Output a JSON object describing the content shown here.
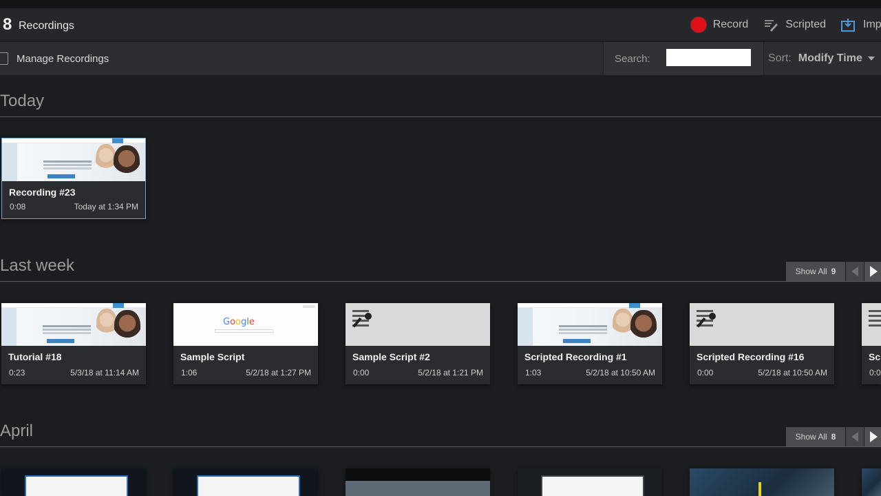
{
  "header": {
    "count": "8",
    "count_label": "Recordings",
    "actions": [
      {
        "label": "Record",
        "icon": "record-icon"
      },
      {
        "label": "Scripted",
        "icon": "scripted-icon"
      },
      {
        "label": "Import",
        "icon": "import-icon"
      }
    ]
  },
  "toolbar": {
    "manage_label": "Manage Recordings",
    "search_label": "Search:",
    "search_value": "",
    "sort_label": "Sort:",
    "sort_value": "Modify Time"
  },
  "sections": {
    "today": {
      "title": "Today",
      "cards": [
        {
          "title": "Recording #23",
          "duration": "0:08",
          "date": "Today at 1:34 PM"
        }
      ]
    },
    "last_week": {
      "title": "Last week",
      "show_all_label": "Show All",
      "show_all_count": "9",
      "cards": [
        {
          "title": "Tutorial #18",
          "duration": "0:23",
          "date": "5/3/18 at 11:14 AM"
        },
        {
          "title": "Sample Script",
          "duration": "1:06",
          "date": "5/2/18 at 1:27 PM",
          "thumb_text": "Google"
        },
        {
          "title": "Sample Script #2",
          "duration": "0:00",
          "date": "5/2/18 at 1:21 PM"
        },
        {
          "title": "Scripted Recording #1",
          "duration": "1:03",
          "date": "5/2/18 at 10:50 AM"
        },
        {
          "title": "Scripted Recording #16",
          "duration": "0:00",
          "date": "5/2/18 at 10:50 AM"
        },
        {
          "title": "Sc",
          "duration": "0:0",
          "date": ""
        }
      ]
    },
    "april": {
      "title": "April",
      "show_all_label": "Show All",
      "show_all_count": "8"
    }
  },
  "colors": {
    "background": "#1c1d20",
    "record_red": "#e0101a",
    "selected_border": "#6ea6d6"
  }
}
